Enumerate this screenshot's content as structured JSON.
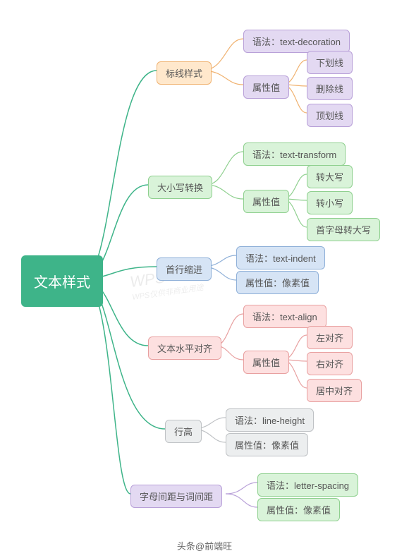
{
  "root": {
    "label": "文本样式"
  },
  "branches": [
    {
      "label": "标线样式",
      "children": [
        {
          "label": "语法：text-decoration"
        },
        {
          "label": "属性值",
          "children": [
            {
              "label": "下划线"
            },
            {
              "label": "删除线"
            },
            {
              "label": "顶划线"
            }
          ]
        }
      ]
    },
    {
      "label": "大小写转换",
      "children": [
        {
          "label": "语法：text-transform"
        },
        {
          "label": "属性值",
          "children": [
            {
              "label": "转大写"
            },
            {
              "label": "转小写"
            },
            {
              "label": "首字母转大写"
            }
          ]
        }
      ]
    },
    {
      "label": "首行缩进",
      "children": [
        {
          "label": "语法：text-indent"
        },
        {
          "label": "属性值：像素值"
        }
      ]
    },
    {
      "label": "文本水平对齐",
      "children": [
        {
          "label": "语法：text-align"
        },
        {
          "label": "属性值",
          "children": [
            {
              "label": "左对齐"
            },
            {
              "label": "右对齐"
            },
            {
              "label": "居中对齐"
            }
          ]
        }
      ]
    },
    {
      "label": "行高",
      "children": [
        {
          "label": "语法：line-height"
        },
        {
          "label": "属性值：像素值"
        }
      ]
    },
    {
      "label": "字母间距与词间距",
      "children": [
        {
          "label": "语法：letter-spacing"
        },
        {
          "label": "属性值：像素值"
        }
      ]
    }
  ],
  "watermark": {
    "main": "WPS",
    "sub": "WPS仅供非商业用途"
  },
  "footer": "头条@前端旺",
  "chart_data": {
    "type": "mindmap",
    "title": "文本样式",
    "root": "文本样式",
    "children": [
      {
        "node": "标线样式",
        "children": [
          {
            "node": "语法：text-decoration"
          },
          {
            "node": "属性值",
            "children": [
              "下划线",
              "删除线",
              "顶划线"
            ]
          }
        ]
      },
      {
        "node": "大小写转换",
        "children": [
          {
            "node": "语法：text-transform"
          },
          {
            "node": "属性值",
            "children": [
              "转大写",
              "转小写",
              "首字母转大写"
            ]
          }
        ]
      },
      {
        "node": "首行缩进",
        "children": [
          {
            "node": "语法：text-indent"
          },
          {
            "node": "属性值：像素值"
          }
        ]
      },
      {
        "node": "文本水平对齐",
        "children": [
          {
            "node": "语法：text-align"
          },
          {
            "node": "属性值",
            "children": [
              "左对齐",
              "右对齐",
              "居中对齐"
            ]
          }
        ]
      },
      {
        "node": "行高",
        "children": [
          {
            "node": "语法：line-height"
          },
          {
            "node": "属性值：像素值"
          }
        ]
      },
      {
        "node": "字母间距与词间距",
        "children": [
          {
            "node": "语法：letter-spacing"
          },
          {
            "node": "属性值：像素值"
          }
        ]
      }
    ]
  }
}
